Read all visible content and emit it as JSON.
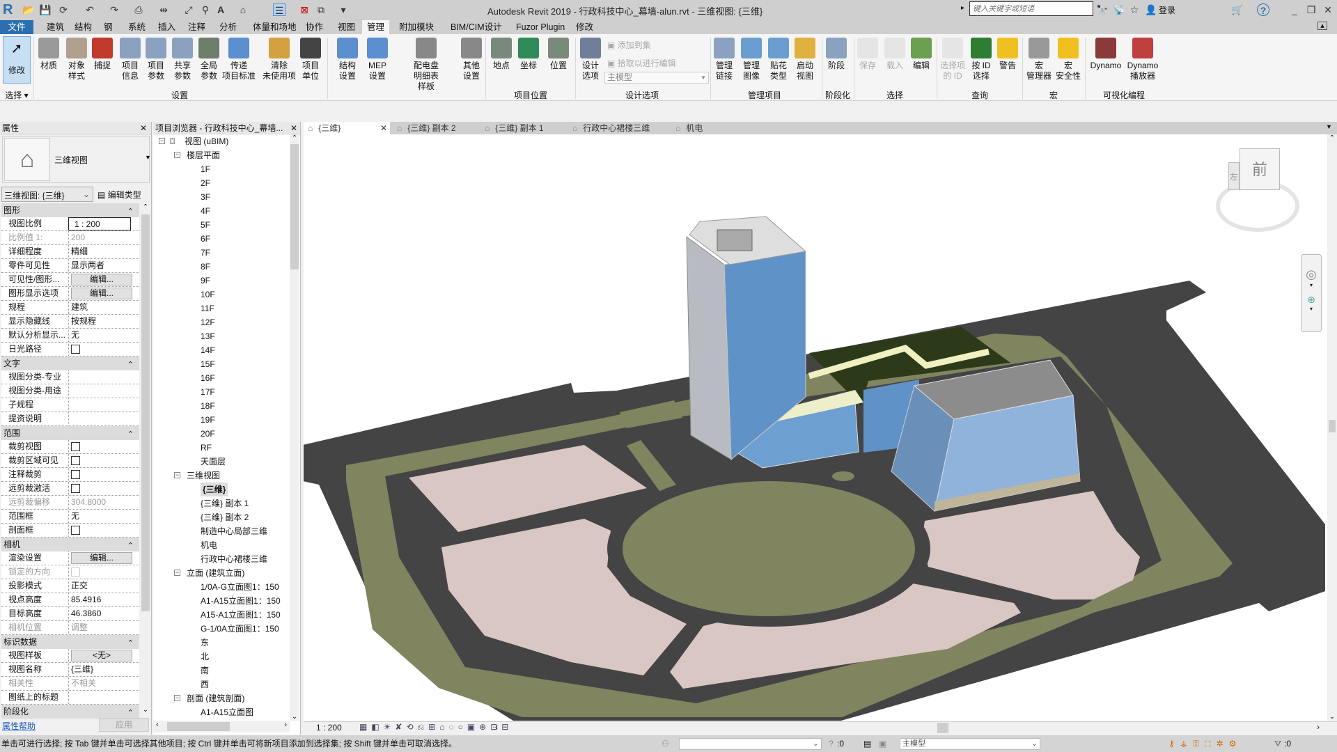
{
  "window": {
    "title": "Autodesk Revit 2019 - 行政科技中心_幕墙-alun.rvt - 三维视图: {三维}",
    "search_placeholder": "键入关键字或短语",
    "login": "登录"
  },
  "ribbon_tabs": [
    "文件",
    "建筑",
    "结构",
    "钢",
    "系统",
    "插入",
    "注释",
    "分析",
    "体量和场地",
    "协作",
    "视图",
    "管理",
    "附加模块",
    "BIM/CIM设计",
    "Fuzor Plugin",
    "修改"
  ],
  "active_tab": "管理",
  "ribbon": {
    "modify": "修改",
    "select_panel": "选择 ▾",
    "buttons": [
      {
        "label": "材质",
        "icon": "material-sphere-icon",
        "color": "#9a9a9a"
      },
      {
        "label": "对象\n样式",
        "icon": "object-styles-icon",
        "color": "#b0a090"
      },
      {
        "label": "捕捉",
        "icon": "snap-magnet-icon",
        "color": "#c0392b"
      },
      {
        "label": "项目\n信息",
        "icon": "project-info-icon",
        "color": "#8aa2c0"
      },
      {
        "label": "项目\n参数",
        "icon": "project-parameters-icon",
        "color": "#8aa2c0"
      },
      {
        "label": "共享\n参数",
        "icon": "shared-parameters-icon",
        "color": "#8aa2c0"
      },
      {
        "label": "全局\n参数",
        "icon": "global-parameters-icon",
        "color": "#6d7f6a"
      },
      {
        "label": "传递\n项目标准",
        "icon": "transfer-standards-icon",
        "color": "#5b8fd0"
      },
      {
        "label": "清除\n未使用项",
        "icon": "purge-unused-icon",
        "color": "#d4a040"
      },
      {
        "label": "项目\n单位",
        "icon": "project-units-icon",
        "color": "#444444"
      },
      {
        "label": "结构\n设置",
        "icon": "structural-settings-icon",
        "color": "#5b8fd0"
      },
      {
        "label": "MEP\n设置",
        "icon": "mep-settings-icon",
        "color": "#5b8fd0"
      },
      {
        "label": "配电盘明细表\n样板",
        "icon": "panel-schedule-icon",
        "color": "#888888"
      },
      {
        "label": "其他\n设置",
        "icon": "wrench-icon",
        "color": "#888888"
      },
      {
        "label": "地点",
        "icon": "location-globe-icon",
        "color": "#7a8a7a"
      },
      {
        "label": "坐标",
        "icon": "coordinates-axes-icon",
        "color": "#2e8b57"
      },
      {
        "label": "位置",
        "icon": "position-globe-icon",
        "color": "#7a8a7a"
      },
      {
        "label": "设计\n选项",
        "icon": "design-options-icon",
        "color": "#6f7f99"
      },
      {
        "label": "管理\n链接",
        "icon": "manage-links-icon",
        "color": "#8aa2c0"
      },
      {
        "label": "管理\n图像",
        "icon": "manage-images-icon",
        "color": "#6a9ed0"
      },
      {
        "label": "贴花\n类型",
        "icon": "decal-types-icon",
        "color": "#6a9ed0"
      },
      {
        "label": "启动\n视图",
        "icon": "starting-view-icon",
        "color": "#e0b040"
      },
      {
        "label": "阶段",
        "icon": "phases-icon",
        "color": "#8aa2c0"
      },
      {
        "label": "保存",
        "icon": "save-selection-icon",
        "color": "#cccccc",
        "disabled": true
      },
      {
        "label": "载入",
        "icon": "load-selection-icon",
        "color": "#cccccc",
        "disabled": true
      },
      {
        "label": "编辑",
        "icon": "edit-selection-icon",
        "color": "#6aa050"
      },
      {
        "label": "选择项\n的 ID",
        "icon": "ids-of-selection-icon",
        "color": "#cccccc",
        "disabled": true
      },
      {
        "label": "按 ID\n选择",
        "icon": "select-by-id-icon",
        "color": "#2e7d32"
      },
      {
        "label": "警告",
        "icon": "warnings-icon",
        "color": "#f0c020"
      },
      {
        "label": "宏\n管理器",
        "icon": "macro-manager-icon",
        "color": "#999999"
      },
      {
        "label": "宏\n安全性",
        "icon": "macro-security-icon",
        "color": "#f0c020"
      },
      {
        "label": "Dynamo",
        "icon": "dynamo-icon",
        "color": "#8b3a3a"
      },
      {
        "label": "Dynamo\n播放器",
        "icon": "dynamo-player-icon",
        "color": "#c04040"
      }
    ],
    "small": {
      "add_to_set": "添加到集",
      "pick_to_edit": "拾取以进行编辑",
      "main_model": "主模型"
    },
    "panels": [
      "选择",
      "设置",
      "项目位置",
      "设计选项",
      "管理项目",
      "阶段化",
      "选择",
      "查询",
      "宏",
      "可视化编程"
    ]
  },
  "properties": {
    "title": "属性",
    "type_name": "三维视图",
    "selector": "三维视图: {三维}",
    "edit_type": "编辑类型",
    "groups": [
      {
        "name": "图形",
        "rows": [
          {
            "label": "视图比例",
            "value": "1 : 200",
            "kind": "input"
          },
          {
            "label": "比例值 1:",
            "value": "200",
            "dim": true
          },
          {
            "label": "详细程度",
            "value": "精细"
          },
          {
            "label": "零件可见性",
            "value": "显示两者"
          },
          {
            "label": "可见性/图形...",
            "value": "编辑...",
            "kind": "button"
          },
          {
            "label": "图形显示选项",
            "value": "编辑...",
            "kind": "button"
          },
          {
            "label": "规程",
            "value": "建筑"
          },
          {
            "label": "显示隐藏线",
            "value": "按规程"
          },
          {
            "label": "默认分析显示...",
            "value": "无"
          },
          {
            "label": "日光路径",
            "value": "",
            "kind": "check"
          }
        ]
      },
      {
        "name": "文字",
        "rows": [
          {
            "label": "视图分类-专业",
            "value": ""
          },
          {
            "label": "视图分类-用途",
            "value": ""
          },
          {
            "label": "子规程",
            "value": ""
          },
          {
            "label": "提资说明",
            "value": ""
          }
        ]
      },
      {
        "name": "范围",
        "rows": [
          {
            "label": "裁剪视图",
            "value": "",
            "kind": "check"
          },
          {
            "label": "裁剪区域可见",
            "value": "",
            "kind": "check"
          },
          {
            "label": "注释裁剪",
            "value": "",
            "kind": "check"
          },
          {
            "label": "远剪裁激活",
            "value": "",
            "kind": "check"
          },
          {
            "label": "远剪裁偏移",
            "value": "304.8000",
            "dim": true
          },
          {
            "label": "范围框",
            "value": "无"
          },
          {
            "label": "剖面框",
            "value": "",
            "kind": "check"
          }
        ]
      },
      {
        "name": "相机",
        "rows": [
          {
            "label": "渲染设置",
            "value": "编辑...",
            "kind": "button"
          },
          {
            "label": "锁定的方向",
            "value": "",
            "kind": "check",
            "dim": true
          },
          {
            "label": "投影模式",
            "value": "正交"
          },
          {
            "label": "视点高度",
            "value": "85.4916"
          },
          {
            "label": "目标高度",
            "value": "46.3860"
          },
          {
            "label": "相机位置",
            "value": "调整",
            "dim": true
          }
        ]
      },
      {
        "name": "标识数据",
        "rows": [
          {
            "label": "视图样板",
            "value": "<无>",
            "kind": "button"
          },
          {
            "label": "视图名称",
            "value": "{三维}"
          },
          {
            "label": "相关性",
            "value": "不相关",
            "dim": true
          },
          {
            "label": "图纸上的标题",
            "value": ""
          }
        ]
      },
      {
        "name": "阶段化",
        "rows": []
      }
    ],
    "help": "属性帮助",
    "apply": "应用"
  },
  "browser": {
    "title": "项目浏览器 - 行政科技中心_幕墙...",
    "tree": [
      {
        "t": "视图 (uBIM)",
        "l": 0,
        "exp": true
      },
      {
        "t": "楼层平面",
        "l": 1,
        "exp": true
      },
      {
        "t": "1F",
        "l": 2
      },
      {
        "t": "2F",
        "l": 2
      },
      {
        "t": "3F",
        "l": 2
      },
      {
        "t": "4F",
        "l": 2
      },
      {
        "t": "5F",
        "l": 2
      },
      {
        "t": "6F",
        "l": 2
      },
      {
        "t": "7F",
        "l": 2
      },
      {
        "t": "8F",
        "l": 2
      },
      {
        "t": "9F",
        "l": 2
      },
      {
        "t": "10F",
        "l": 2
      },
      {
        "t": "11F",
        "l": 2
      },
      {
        "t": "12F",
        "l": 2
      },
      {
        "t": "13F",
        "l": 2
      },
      {
        "t": "14F",
        "l": 2
      },
      {
        "t": "15F",
        "l": 2
      },
      {
        "t": "16F",
        "l": 2
      },
      {
        "t": "17F",
        "l": 2
      },
      {
        "t": "18F",
        "l": 2
      },
      {
        "t": "19F",
        "l": 2
      },
      {
        "t": "20F",
        "l": 2
      },
      {
        "t": "RF",
        "l": 2
      },
      {
        "t": "天面层",
        "l": 2
      },
      {
        "t": "三维视图",
        "l": 1,
        "exp": true
      },
      {
        "t": "{三维}",
        "l": 2,
        "sel": true
      },
      {
        "t": "{三维} 副本 1",
        "l": 2
      },
      {
        "t": "{三维} 副本 2",
        "l": 2
      },
      {
        "t": "制造中心局部三维",
        "l": 2
      },
      {
        "t": "机电",
        "l": 2
      },
      {
        "t": "行政中心裙楼三维",
        "l": 2
      },
      {
        "t": "立面 (建筑立面)",
        "l": 1,
        "exp": true
      },
      {
        "t": "1/0A-G立面图1：150",
        "l": 2
      },
      {
        "t": "A1-A15立面图1：150",
        "l": 2
      },
      {
        "t": "A15-A1立面图1：150",
        "l": 2
      },
      {
        "t": "G-1/0A立面图1：150",
        "l": 2
      },
      {
        "t": "东",
        "l": 2
      },
      {
        "t": "北",
        "l": 2
      },
      {
        "t": "南",
        "l": 2
      },
      {
        "t": "西",
        "l": 2
      },
      {
        "t": "剖面 (建筑剖面)",
        "l": 1,
        "exp": true
      },
      {
        "t": "A1-A15立面图",
        "l": 2
      }
    ]
  },
  "view_tabs": [
    {
      "label": "{三维}",
      "active": true
    },
    {
      "label": "{三维} 副本 2"
    },
    {
      "label": "{三维} 副本 1"
    },
    {
      "label": "行政中心裙楼三维"
    },
    {
      "label": "机电"
    }
  ],
  "viewcube": {
    "face": "前",
    "left": "左"
  },
  "view_control": {
    "scale": "1 : 200"
  },
  "status": {
    "hint": "单击可进行选择; 按 Tab 键并单击可选择其他项目; 按 Ctrl 键并单击可将新项目添加到选择集; 按 Shift 键并单击可取消选择。",
    "worksets": ":0",
    "model": "主模型",
    "filter": ":0"
  },
  "colors": {
    "file_tab": "#2b6fb1",
    "road": "#444444",
    "grass": "#80845f",
    "parcel": "#d8c7c3",
    "glass": "#5f93c8"
  }
}
